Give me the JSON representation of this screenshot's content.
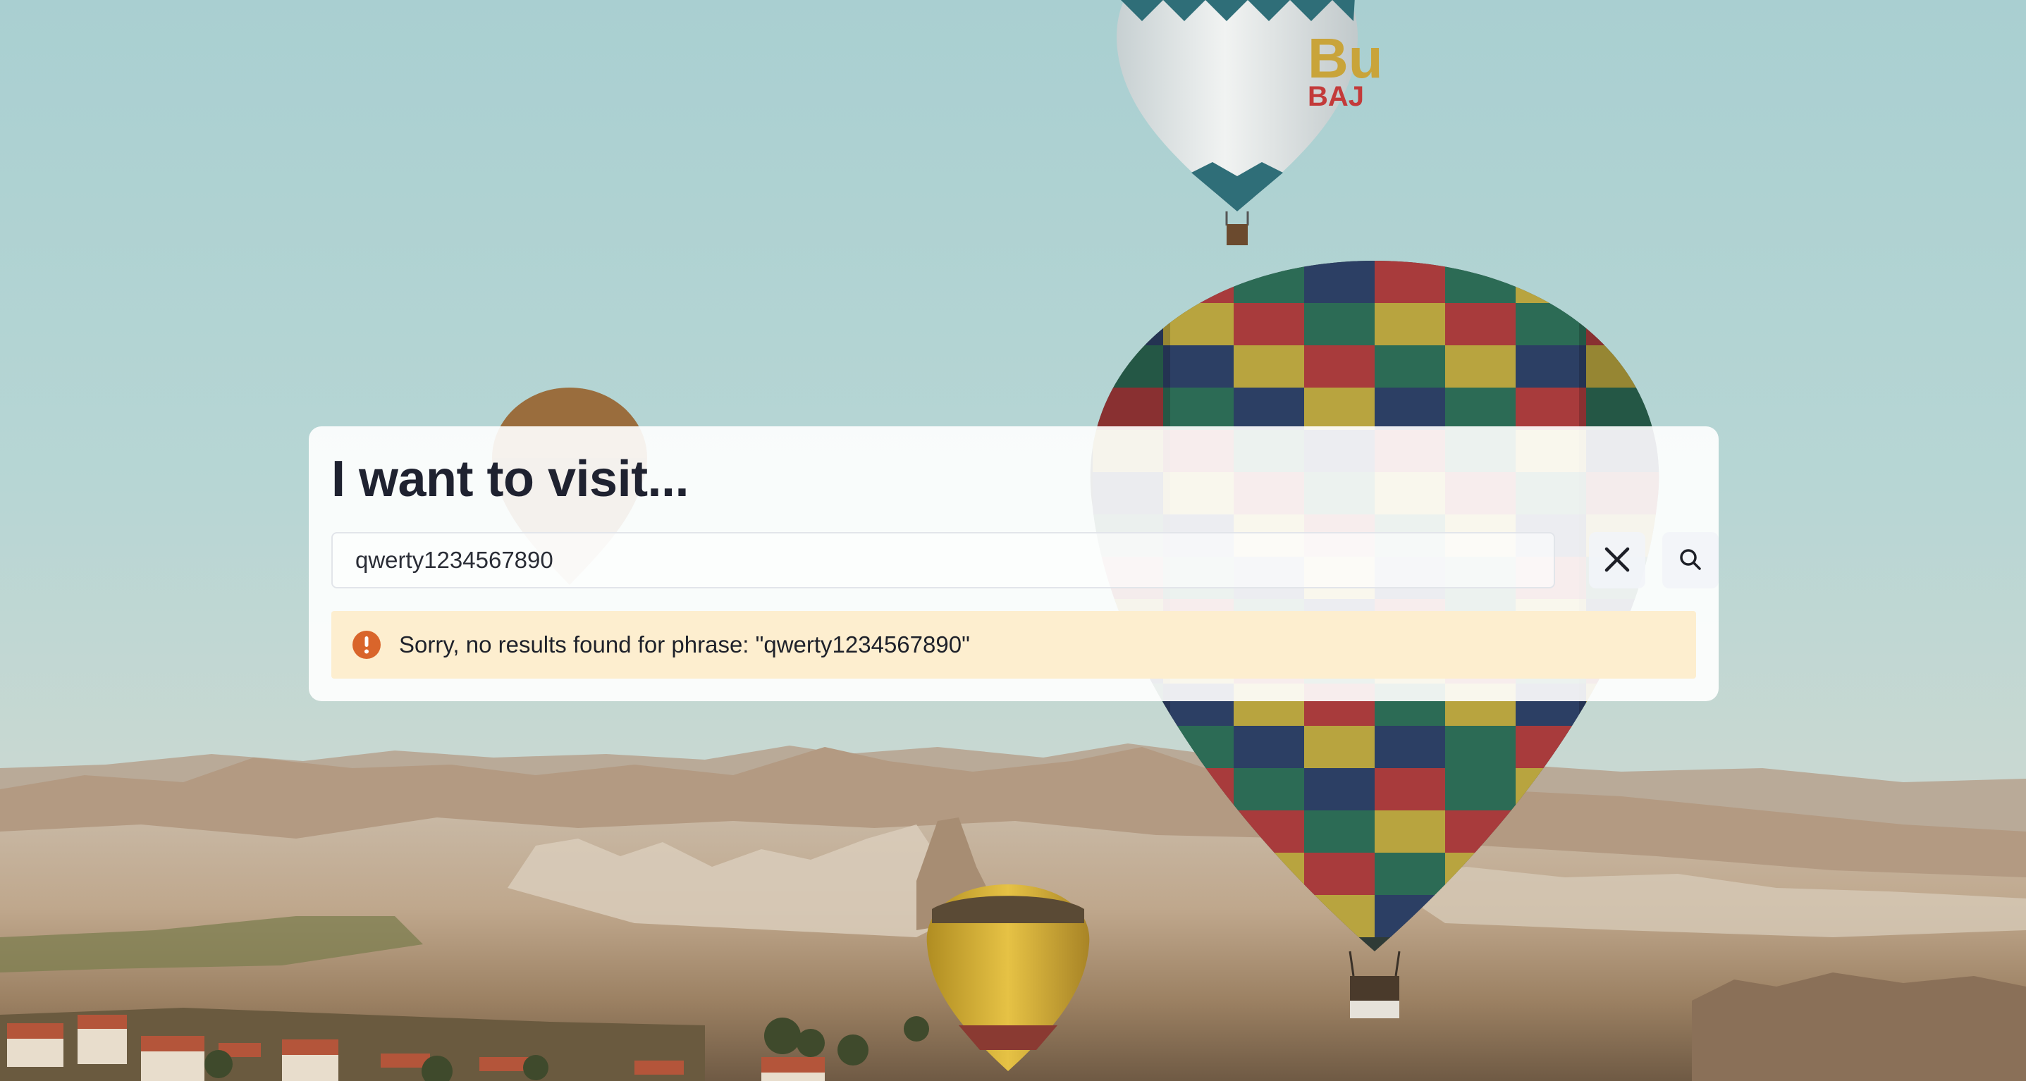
{
  "search": {
    "title": "I want to visit...",
    "query": "qwerty1234567890",
    "clear_icon": "close-icon",
    "search_icon": "search-icon"
  },
  "alert": {
    "icon": "exclamation-icon",
    "message": "Sorry, no results found for phrase: \"qwerty1234567890\"",
    "color": "#fdeecf",
    "icon_color": "#d9652b"
  }
}
